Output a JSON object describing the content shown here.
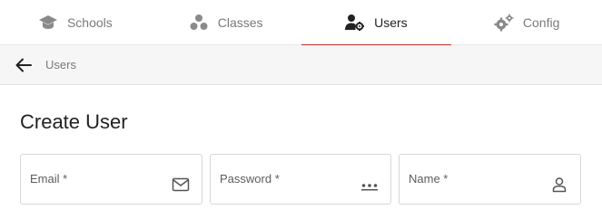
{
  "tabs": [
    {
      "label": "Schools",
      "icon": "graduation-cap-icon",
      "active": false
    },
    {
      "label": "Classes",
      "icon": "group-dots-icon",
      "active": false
    },
    {
      "label": "Users",
      "icon": "user-gear-icon",
      "active": true
    },
    {
      "label": "Config",
      "icon": "gears-icon",
      "active": false
    }
  ],
  "breadcrumb": {
    "back_icon": "arrow-left-icon",
    "current": "Users"
  },
  "page": {
    "title": "Create User"
  },
  "form": {
    "fields": [
      {
        "label": "Email *",
        "icon": "mail-icon"
      },
      {
        "label": "Password *",
        "icon": "password-dots-icon"
      },
      {
        "label": "Name *",
        "icon": "person-icon"
      }
    ]
  },
  "colors": {
    "accent": "#c62828",
    "inactive_text": "#7a7a7a",
    "active_text": "#222222",
    "toolbar_bg": "#f6f6f6"
  }
}
